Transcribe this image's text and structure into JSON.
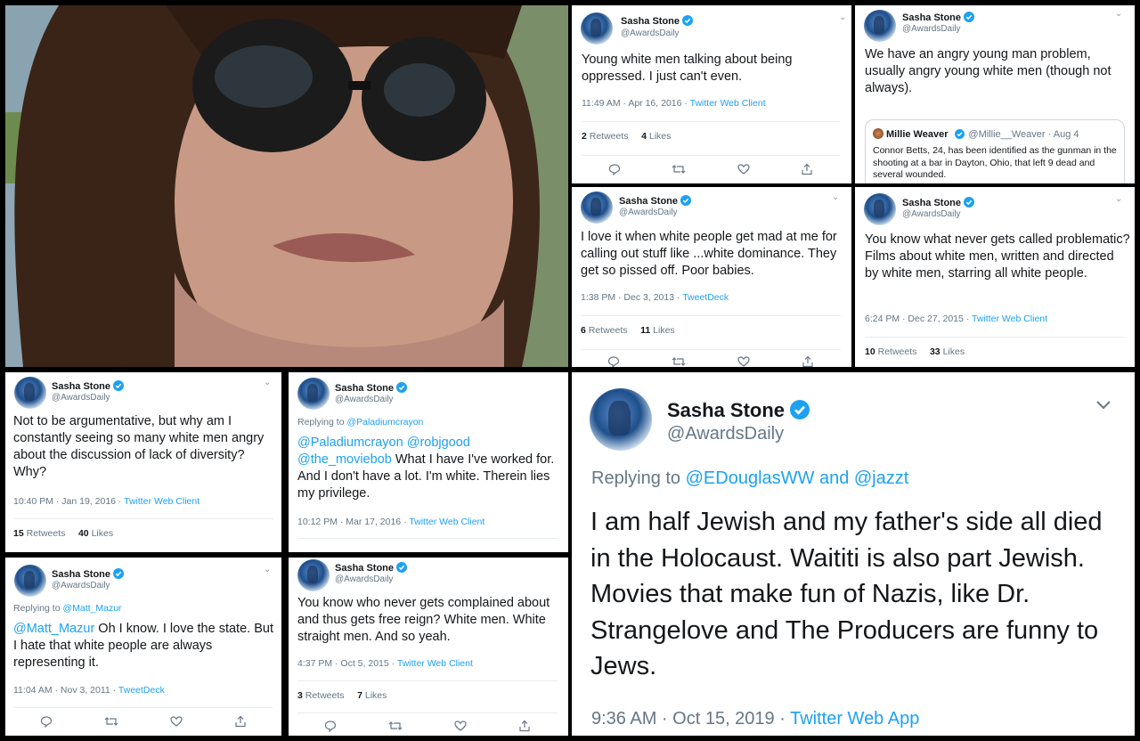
{
  "author": {
    "name": "Sasha Stone",
    "handle": "@AwardsDaily"
  },
  "tweets": {
    "t1": {
      "text": "Young white men talking about being oppressed. I just can't even.",
      "time": "11:49 AM · Apr 16, 2016 · ",
      "client": "Twitter Web Client",
      "retweets": "2",
      "retweets_label": " Retweets",
      "likes": "4",
      "likes_label": " Likes"
    },
    "t2": {
      "text": "We have an angry young man problem, usually angry young white men (though not always).",
      "quote": {
        "name": "Millie Weaver",
        "handle": "@Millie__Weaver · Aug 4",
        "text": "Connor Betts, 24, has been identified as the gunman in the shooting at a bar in Dayton, Ohio, that left 9 dead and several wounded."
      }
    },
    "t3": {
      "text": "I love it when white people get mad at me for calling out stuff like ...white dominance. They get so pissed off. Poor babies.",
      "time": "1:38 PM · Dec 3, 2013 · ",
      "client": "TweetDeck",
      "retweets": "6",
      "retweets_label": " Retweets",
      "likes": "11",
      "likes_label": " Likes"
    },
    "t4": {
      "text": "You know what never gets called problematic? Films about white men, written and directed by white men, starring all white people.",
      "time": "6:24 PM · Dec 27, 2015 · ",
      "client": "Twitter Web Client",
      "retweets": "10",
      "retweets_label": " Retweets",
      "likes": "33",
      "likes_label": " Likes"
    },
    "t5": {
      "text": "Not to be argumentative, but why am I constantly seeing so many white men angry about the discussion of lack of diversity? Why?",
      "time": "10:40 PM · Jan 19, 2016 · ",
      "client": "Twitter Web Client",
      "retweets": "15",
      "retweets_label": " Retweets",
      "likes": "40",
      "likes_label": " Likes"
    },
    "t6": {
      "replying_prefix": "Replying to ",
      "replying_to": "@Paladiumcrayon",
      "mentions": "@Paladiumcrayon @robjgood @the_moviebob",
      "text": " What I have I've worked for. And I don't have a lot. I'm white. Therein lies my privilege.",
      "time": "10:12 PM · Mar 17, 2016 · ",
      "client": "Twitter Web Client"
    },
    "t7": {
      "replying_prefix": "Replying to ",
      "replying_to": "@Matt_Mazur",
      "mentions": "@Matt_Mazur",
      "text": " Oh I know.  I love the state. But I hate that white people are always representing it.",
      "time": "11:04 AM · Nov 3, 2011 · ",
      "client": "TweetDeck"
    },
    "t8": {
      "text": "You know who never gets complained about and thus gets free reign? White men. White straight men.  And so yeah.",
      "time": "4:37 PM · Oct 5, 2015 · ",
      "client": "Twitter Web Client",
      "retweets": "3",
      "retweets_label": " Retweets",
      "likes": "7",
      "likes_label": " Likes"
    },
    "t9": {
      "replying_prefix": "Replying to ",
      "replying_to": "@EDouglasWW and @jazzt",
      "text": "I am half Jewish and my father's side all died in the Holocaust. Waititi is also part Jewish. Movies that make fun of Nazis, like Dr. Strangelove and The Producers are funny to Jews.",
      "time": "9:36 AM · Oct 15, 2019 · ",
      "client": "Twitter Web App"
    }
  },
  "icons": [
    "reply-icon",
    "retweet-icon",
    "like-icon",
    "share-icon",
    "verified-icon",
    "chevron-down-icon"
  ],
  "colors": {
    "link": "#1da1f2",
    "muted": "#657786",
    "text": "#14171a"
  }
}
